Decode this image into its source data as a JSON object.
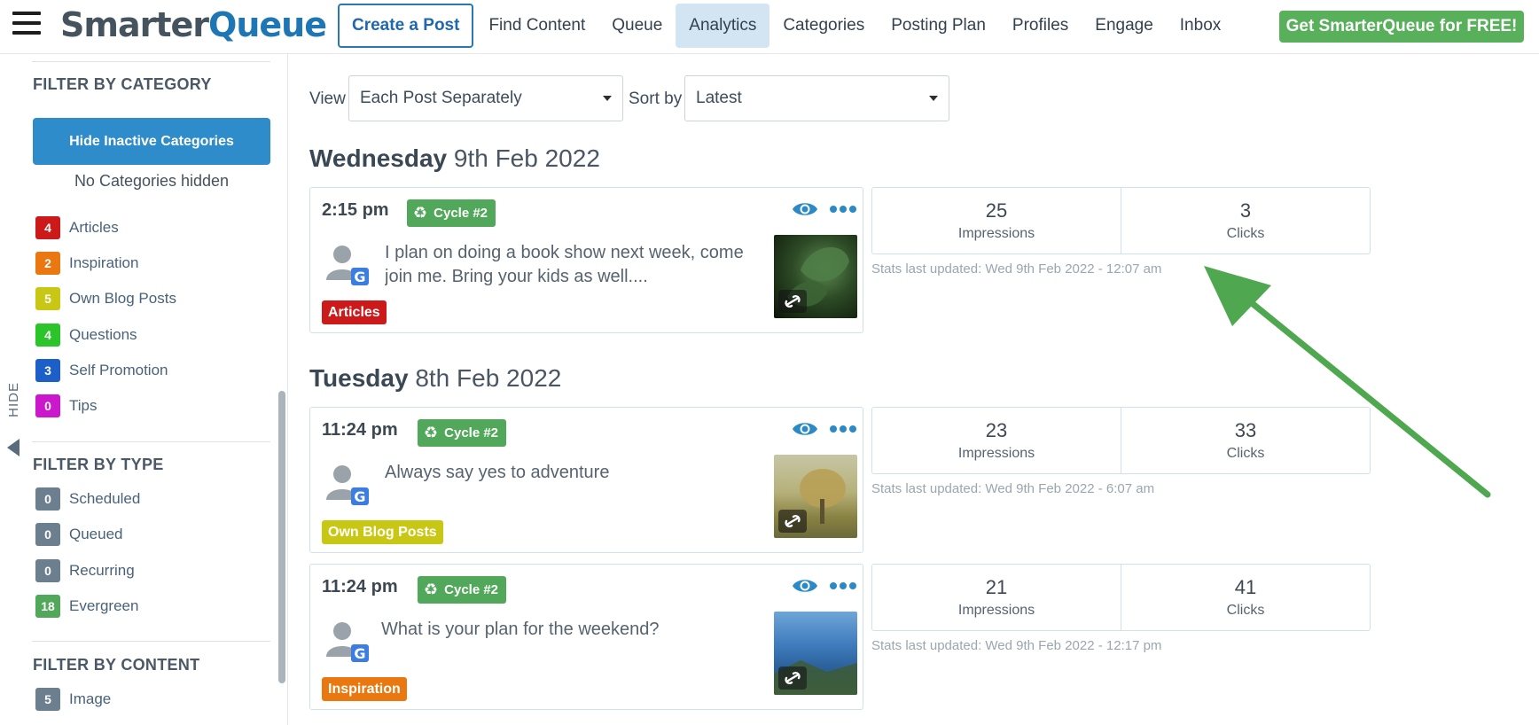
{
  "nav": {
    "logo_a": "Smarter",
    "logo_b": "Queue",
    "items": [
      {
        "label": "Create a Post"
      },
      {
        "label": "Find Content"
      },
      {
        "label": "Queue"
      },
      {
        "label": "Analytics"
      },
      {
        "label": "Categories"
      },
      {
        "label": "Posting Plan"
      },
      {
        "label": "Profiles"
      },
      {
        "label": "Engage"
      },
      {
        "label": "Inbox"
      }
    ],
    "active": "Analytics",
    "cta": "Get SmarterQueue for FREE!"
  },
  "sidebar": {
    "category_heading": "FILTER BY CATEGORY",
    "hide_button": "Hide Inactive Categories",
    "hidden_status": "No Categories hidden",
    "categories": [
      {
        "count": "4",
        "label": "Articles",
        "color": "#cc1a1a"
      },
      {
        "count": "2",
        "label": "Inspiration",
        "color": "#e8780f"
      },
      {
        "count": "5",
        "label": "Own Blog Posts",
        "color": "#c8c814"
      },
      {
        "count": "4",
        "label": "Questions",
        "color": "#2bc42b"
      },
      {
        "count": "3",
        "label": "Self Promotion",
        "color": "#1c5fc9"
      },
      {
        "count": "0",
        "label": "Tips",
        "color": "#cc18cc"
      }
    ],
    "type_heading": "FILTER BY TYPE",
    "types": [
      {
        "count": "0",
        "label": "Scheduled",
        "color": "#6b7f8f"
      },
      {
        "count": "0",
        "label": "Queued",
        "color": "#6b7f8f"
      },
      {
        "count": "0",
        "label": "Recurring",
        "color": "#6b7f8f"
      },
      {
        "count": "18",
        "label": "Evergreen",
        "color": "#52a85a"
      }
    ],
    "content_heading": "FILTER BY CONTENT",
    "contents": [
      {
        "count": "5",
        "label": "Image",
        "color": "#6b7f8f"
      }
    ],
    "toggle_label": "HIDE"
  },
  "controls": {
    "view_label": "View",
    "view_value": "Each Post Separately",
    "sort_label": "Sort by",
    "sort_value": "Latest"
  },
  "days": [
    {
      "weekday": "Wednesday",
      "date": "9th Feb 2022"
    },
    {
      "weekday": "Tuesday",
      "date": "8th Feb 2022"
    }
  ],
  "posts": [
    {
      "time": "2:15 pm",
      "cycle": "Cycle #2",
      "text": "I plan on doing a book show next week, come join me. Bring your kids as well....",
      "category": "Articles",
      "category_color": "#cc1a1a",
      "impressions": "25",
      "clicks": "3",
      "updated": "Stats last updated: Wed 9th Feb 2022 - 12:07 am"
    },
    {
      "time": "11:24 pm",
      "cycle": "Cycle #2",
      "text": "Always say yes to adventure",
      "category": "Own Blog Posts",
      "category_color": "#c8c814",
      "impressions": "23",
      "clicks": "33",
      "updated": "Stats last updated: Wed 9th Feb 2022 - 6:07 am"
    },
    {
      "time": "11:24 pm",
      "cycle": "Cycle #2",
      "text": "What is your plan for the weekend?",
      "category": "Inspiration",
      "category_color": "#e8780f",
      "impressions": "21",
      "clicks": "41",
      "updated": "Stats last updated: Wed 9th Feb 2022 - 12:17 pm"
    }
  ],
  "stat_labels": {
    "impressions": "Impressions",
    "clicks": "Clicks"
  },
  "colors": {
    "brand_blue": "#2f8cca",
    "cta_green": "#58b05a",
    "arrow_green": "#4fa84f"
  }
}
